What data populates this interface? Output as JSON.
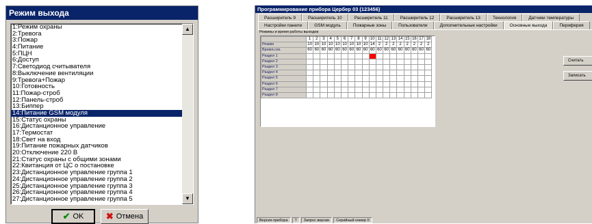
{
  "dialog": {
    "title": "Режим выхода",
    "selected_index": 13,
    "items": [
      "1:Режим охраны",
      "2:Тревога",
      "3:Пожар",
      "4:Питание",
      "5:ПЦН",
      "6:Доступ",
      "7:Светодиод считывателя",
      "8:Выключение вентиляции",
      "9:Тревога+Пожар",
      "10:Готовность",
      "11:Пожар-строб",
      "12:Панель-строб",
      "13:Биппер",
      "14:Питание GSM модуля",
      "15:Статус охраны",
      "16:Дистанционное управление",
      "17:Термостат",
      "18:Свет на вход",
      "19:Питание пожарных датчиков",
      "20:Отключение 220 В",
      "21:Статус охраны с общими зонами",
      "22:Квитанция от ЦС о постановке",
      "23:Дистанционное управление группа 1",
      "24:Дистанционное управление группа 2",
      "25:Дистанционное управление группа 3",
      "26:Дистанционное управление группа 4",
      "27:Дистанционное управление группа 5"
    ],
    "ok_label": "OK",
    "cancel_label": "Отмена"
  },
  "window": {
    "title": "Программирование прибора Цербер 03 (123456)",
    "tabs_row1": [
      "Расширитель 9",
      "Расширитель 10",
      "Расширитель 11",
      "Расширитель 12",
      "Расширитель 13",
      "Технология",
      "Датчики температуры"
    ],
    "tabs_row2": [
      "Настройки панели",
      "GSM модуль",
      "Пожарные зоны",
      "Пользователи",
      "Дополнительные настройки",
      "Основные выхода",
      "Периферия"
    ],
    "active_tab": "Основные выхода",
    "grid_title": "Режимы и время работы выходов",
    "columns": [
      "1",
      "2",
      "3",
      "4",
      "5",
      "6",
      "7",
      "8",
      "9",
      "10",
      "11",
      "12",
      "13",
      "14",
      "15",
      "16",
      "17",
      "18"
    ],
    "rows": [
      {
        "label": "Режим",
        "values": [
          "10",
          "10",
          "10",
          "10",
          "10",
          "10",
          "10",
          "10",
          "10",
          "14",
          "2",
          "2",
          "2",
          "2",
          "2",
          "2",
          "2",
          "2"
        ]
      },
      {
        "label": "Время,сек.",
        "values": [
          "60",
          "60",
          "60",
          "60",
          "60",
          "60",
          "60",
          "60",
          "60",
          "60",
          "60",
          "60",
          "60",
          "60",
          "60",
          "60",
          "60",
          "60"
        ]
      }
    ],
    "sections": [
      "Раздел 1",
      "Раздел 2",
      "Раздел 3",
      "Раздел 4",
      "Раздел 5",
      "Раздел 6",
      "Раздел 7",
      "Раздел 8"
    ],
    "marked_cell": {
      "section": 1,
      "column": 10
    },
    "read_button": "Считать",
    "write_button": "Записать",
    "status": [
      "Версия прибора",
      "?",
      "Запрос версии",
      "Серийный номер 0"
    ]
  }
}
